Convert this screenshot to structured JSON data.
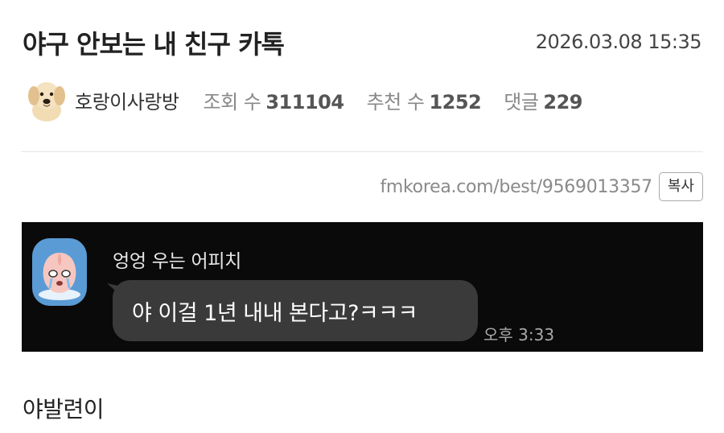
{
  "post": {
    "title": "야구 안보는 내 친구 카톡",
    "date": "2026.03.08 15:35",
    "author": "호랑이사랑방",
    "author_avatar_icon": "puppy-icon",
    "views_label": "조회 수",
    "views": "311104",
    "recommend_label": "추천 수",
    "recommend": "1252",
    "comments_label": "댓글",
    "comments": "229",
    "url": "fmkorea.com/best/9569013357",
    "copy_label": "복사",
    "body_text": "야발련이"
  },
  "chat": {
    "background": "#0a0a0a",
    "bubble_color": "#3a3a3a",
    "sender_avatar_icon": "crying-apeach-icon",
    "sender_name": "엉엉 우는 어피치",
    "message": "야 이걸 1년 내내 본다고?ㅋㅋㅋ",
    "time": "오후 3:33"
  }
}
